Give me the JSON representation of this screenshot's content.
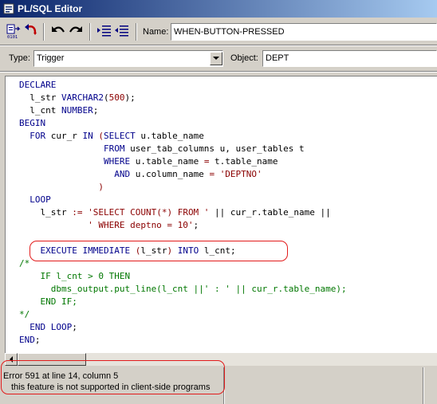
{
  "window": {
    "title": "PL/SQL Editor"
  },
  "toolbar": {
    "name_label": "Name:",
    "name_value": "WHEN-BUTTON-PRESSED",
    "icons": [
      "compile-icon",
      "revert-icon",
      "undo-icon",
      "redo-icon",
      "indent-icon",
      "outdent-icon"
    ]
  },
  "filter": {
    "type_label": "Type:",
    "type_value": "Trigger",
    "object_label": "Object:",
    "object_value": "DEPT"
  },
  "colors": {
    "keyword": "#00008b",
    "string": "#8b0000",
    "comment": "#007700",
    "highlight": "#e21b1b"
  },
  "code": {
    "lines": [
      [
        {
          "t": "DECLARE",
          "c": "kw"
        }
      ],
      [
        {
          "t": "  l_str "
        },
        {
          "t": "VARCHAR2",
          "c": "kw"
        },
        {
          "t": "("
        },
        {
          "t": "500",
          "c": "str"
        },
        {
          "t": ");"
        }
      ],
      [
        {
          "t": "  l_cnt "
        },
        {
          "t": "NUMBER",
          "c": "kw"
        },
        {
          "t": ";"
        }
      ],
      [
        {
          "t": "BEGIN",
          "c": "kw"
        }
      ],
      [
        {
          "t": "  "
        },
        {
          "t": "FOR",
          "c": "kw"
        },
        {
          "t": " cur_r "
        },
        {
          "t": "IN",
          "c": "kw"
        },
        {
          "t": " "
        },
        {
          "t": "(",
          "c": "str"
        },
        {
          "t": "SELECT",
          "c": "kw"
        },
        {
          "t": " u.table_name"
        }
      ],
      [
        {
          "t": "                "
        },
        {
          "t": "FROM",
          "c": "kw"
        },
        {
          "t": " user_tab_columns u, user_tables t"
        }
      ],
      [
        {
          "t": "                "
        },
        {
          "t": "WHERE",
          "c": "kw"
        },
        {
          "t": " u.table_name "
        },
        {
          "t": "=",
          "c": "str"
        },
        {
          "t": " t.table_name"
        }
      ],
      [
        {
          "t": "                  "
        },
        {
          "t": "AND",
          "c": "kw"
        },
        {
          "t": " u.column_name "
        },
        {
          "t": "=",
          "c": "str"
        },
        {
          "t": " "
        },
        {
          "t": "'DEPTNO'",
          "c": "str"
        }
      ],
      [
        {
          "t": "               "
        },
        {
          "t": ")",
          "c": "str"
        }
      ],
      [
        {
          "t": "  "
        },
        {
          "t": "LOOP",
          "c": "kw"
        }
      ],
      [
        {
          "t": "    l_str "
        },
        {
          "t": ":=",
          "c": "str"
        },
        {
          "t": " "
        },
        {
          "t": "'SELECT COUNT(*) FROM '",
          "c": "str"
        },
        {
          "t": " || cur_r.table_name ||"
        }
      ],
      [
        {
          "t": "             "
        },
        {
          "t": "' WHERE deptno = 10'",
          "c": "str"
        },
        {
          "t": ";"
        }
      ],
      [],
      [
        {
          "t": "    "
        },
        {
          "t": "EXECUTE IMMEDIATE",
          "c": "kw"
        },
        {
          "t": " "
        },
        {
          "t": "(",
          "c": "str"
        },
        {
          "t": "l_str"
        },
        {
          "t": ")",
          "c": "str"
        },
        {
          "t": " "
        },
        {
          "t": "INTO",
          "c": "kw"
        },
        {
          "t": " l_cnt;"
        }
      ],
      [
        {
          "t": "/*",
          "c": "cm"
        }
      ],
      [
        {
          "t": "    IF l_cnt > 0 THEN",
          "c": "cm"
        }
      ],
      [
        {
          "t": "      dbms_output.put_line(l_cnt ||' : ' || cur_r.table_name);",
          "c": "cm"
        }
      ],
      [
        {
          "t": "    END IF;",
          "c": "cm"
        }
      ],
      [
        {
          "t": "*/",
          "c": "cm"
        }
      ],
      [
        {
          "t": "  "
        },
        {
          "t": "END LOOP",
          "c": "kw"
        },
        {
          "t": ";"
        }
      ],
      [
        {
          "t": "END",
          "c": "kw"
        },
        {
          "t": ";"
        }
      ]
    ]
  },
  "status": {
    "line1": "Error 591 at line 14, column 5",
    "line2": "this feature is not supported in client-side programs"
  }
}
